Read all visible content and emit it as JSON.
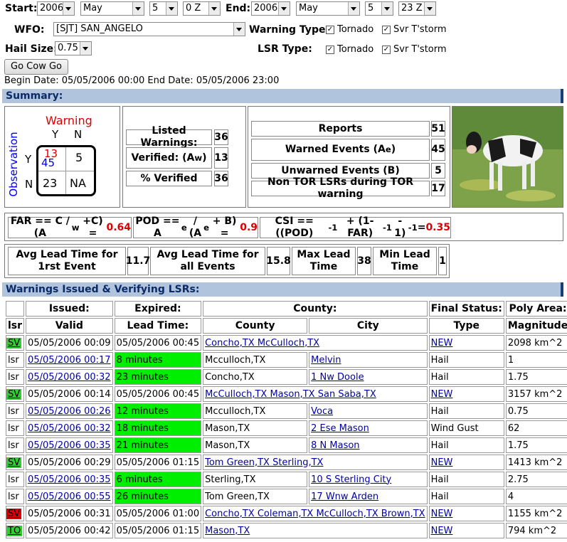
{
  "form": {
    "start_label": "Start:",
    "end_label": "End:",
    "start_year": "2006",
    "start_month": "May",
    "start_day": "5",
    "start_hour": "0 Z",
    "end_year": "2006",
    "end_month": "May",
    "end_day": "5",
    "end_hour": "23 Z",
    "wfo_label": "WFO:",
    "wfo_value": "[SJT] SAN_ANGELO",
    "warning_type_label": "Warning Type:",
    "lsr_type_label": "LSR Type:",
    "tornado_label": "Tornado",
    "svr_label": "Svr T'storm",
    "hail_label": "Hail Size:",
    "hail_value": "0.75",
    "go_button": "Go Cow Go",
    "date_range": "Begin Date: 05/05/2006 00:00 End Date: 05/05/2006 23:00"
  },
  "summary": {
    "title": "Summary:",
    "matrix": {
      "warning": "Warning",
      "observation": "Observation",
      "y": "Y",
      "n": "N",
      "a_red": "13",
      "a_blue": "45",
      "b": "5",
      "c": "23",
      "d": "NA"
    },
    "listed_warnings_label": "Listed Warnings:",
    "listed_warnings": "36",
    "verified_label": "Verified: (A",
    "verified_sub": "w",
    "verified": "13",
    "pct_verified_label": "% Verified",
    "pct_verified": "36",
    "reports_label": "Reports",
    "reports": "51",
    "warned_events_label": "Warned Events (A",
    "warned_sub": "e",
    "warned_events": "45",
    "unwarned_label": "Unwarned Events (B)",
    "unwarned": "5",
    "non_tor_label": "Non TOR LSRs during TOR warning",
    "non_tor": "17",
    "far_text": "FAR == C / (A",
    "far_sub": "w",
    "far_tail": "+C) = ",
    "far_value": "0.64",
    "pod_text": "POD == A",
    "pod_sub": "e",
    "pod_mid": " / (A",
    "pod_sub2": "e",
    "pod_tail": " + B) = ",
    "pod_value": "0.9",
    "csi_text": "CSI == ((POD)",
    "csi_exp1": "-1",
    "csi_mid": " + (1-FAR)",
    "csi_exp2": "-1",
    "csi_mid2": " - 1)",
    "csi_exp3": "-1",
    "csi_tail": " = ",
    "csi_value": "0.35",
    "avg_lead_first_label": "Avg Lead Time for 1rst Event",
    "avg_lead_first": "11.7",
    "avg_lead_all_label": "Avg Lead Time for all Events",
    "avg_lead_all": "15.8",
    "max_lead_label": "Max Lead Time",
    "max_lead": "38",
    "min_lead_label": "Min Lead Time",
    "min_lead": "1"
  },
  "warnings": {
    "title": "Warnings Issued & Verifying LSRs:",
    "header1": [
      "",
      "Issued:",
      "Expired:",
      "County:",
      "Final Status:",
      "Poly Area:"
    ],
    "header2": [
      "lsr",
      "Valid",
      "Lead Time:",
      "County",
      "City",
      "Type",
      "Magnitude"
    ],
    "rows": [
      {
        "kind": "warn",
        "tag": "SV",
        "tagclass": "sv",
        "issued": "05/05/2006 00:09",
        "expired": "05/05/2006 00:45",
        "county": "Concho,TX McCulloch,TX",
        "status": "NEW",
        "area": "2098 km^2"
      },
      {
        "kind": "lsr",
        "tag": "lsr",
        "valid": "05/05/2006 00:17",
        "lead": "8 minutes",
        "county": "Mcculloch,TX",
        "city": "Melvin",
        "type": "Hail",
        "mag": "1"
      },
      {
        "kind": "lsr",
        "tag": "lsr",
        "valid": "05/05/2006 00:32",
        "lead": "23 minutes",
        "county": "Concho,TX",
        "city": "1 Nw Doole",
        "type": "Hail",
        "mag": "1.75"
      },
      {
        "kind": "warn",
        "tag": "SV",
        "tagclass": "sv",
        "issued": "05/05/2006 00:14",
        "expired": "05/05/2006 00:45",
        "county": "McCulloch,TX Mason,TX San Saba,TX",
        "status": "NEW",
        "area": "3157 km^2"
      },
      {
        "kind": "lsr",
        "tag": "lsr",
        "valid": "05/05/2006 00:26",
        "lead": "12 minutes",
        "county": "Mcculloch,TX",
        "city": "Voca",
        "type": "Hail",
        "mag": "0.75"
      },
      {
        "kind": "lsr",
        "tag": "lsr",
        "valid": "05/05/2006 00:32",
        "lead": "18 minutes",
        "county": "Mason,TX",
        "city": "2 Ese Mason",
        "type": "Wind Gust",
        "mag": "62"
      },
      {
        "kind": "lsr",
        "tag": "lsr",
        "valid": "05/05/2006 00:35",
        "lead": "21 minutes",
        "county": "Mason,TX",
        "city": "8 N Mason",
        "type": "Hail",
        "mag": "1.75"
      },
      {
        "kind": "warn",
        "tag": "SV",
        "tagclass": "sv",
        "issued": "05/05/2006 00:29",
        "expired": "05/05/2006 01:15",
        "county": "Tom Green,TX Sterling,TX",
        "status": "NEW",
        "area": "1413 km^2"
      },
      {
        "kind": "lsr",
        "tag": "lsr",
        "valid": "05/05/2006 00:35",
        "lead": "6 minutes",
        "county": "Sterling,TX",
        "city": "10 S Sterling City",
        "type": "Hail",
        "mag": "2.75"
      },
      {
        "kind": "lsr",
        "tag": "lsr",
        "valid": "05/05/2006 00:55",
        "lead": "26 minutes",
        "county": "Tom Green,TX",
        "city": "17 Wnw Arden",
        "type": "Hail",
        "mag": "4"
      },
      {
        "kind": "warn",
        "tag": "SV",
        "tagclass": "svr",
        "issued": "05/05/2006 00:31",
        "expired": "05/05/2006 01:00",
        "county": "Concho,TX Coleman,TX McCulloch,TX Brown,TX",
        "status": "NEW",
        "area": "1155 km^2"
      },
      {
        "kind": "warn",
        "tag": "TO",
        "tagclass": "to",
        "issued": "05/05/2006 00:42",
        "expired": "05/05/2006 01:15",
        "county": "Mason,TX",
        "status": "NEW",
        "area": "794 km^2"
      }
    ]
  }
}
